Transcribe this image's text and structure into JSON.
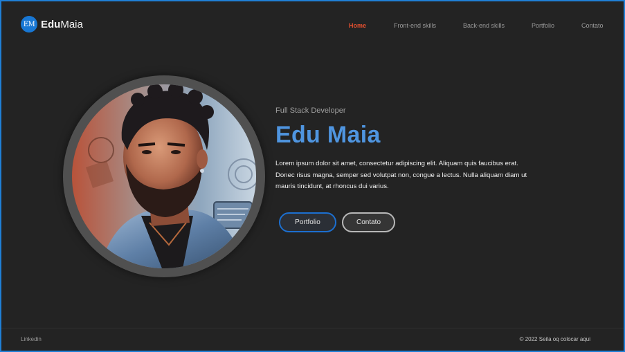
{
  "brand": {
    "badge": "EM",
    "name_bold": "Edu",
    "name_regular": "Maia",
    "accent_color": "#1877d4"
  },
  "nav": {
    "items": [
      {
        "label": "Home",
        "active": true
      },
      {
        "label": "Front-end skills",
        "active": false
      },
      {
        "label": "Back-end skills",
        "active": false
      },
      {
        "label": "Portfolio",
        "active": false
      },
      {
        "label": "Contato",
        "active": false
      }
    ],
    "active_color": "#e5502f"
  },
  "hero": {
    "subtitle": "Full Stack Developer",
    "title": "Edu Maia",
    "title_color": "#4f95e0",
    "description": "Lorem ipsum dolor sit amet, consectetur adipiscing elit. Aliquam quis faucibus erat. Donec risus magna, semper sed volutpat non, congue a lectus. Nulla aliquam diam ut mauris tincidunt, at rhoncus dui varius.",
    "buttons": {
      "portfolio": "Portfolio",
      "contato": "Contato"
    }
  },
  "footer": {
    "left_link": "Linkedin",
    "copyright": "© 2022 Seila oq colocar aqui"
  }
}
